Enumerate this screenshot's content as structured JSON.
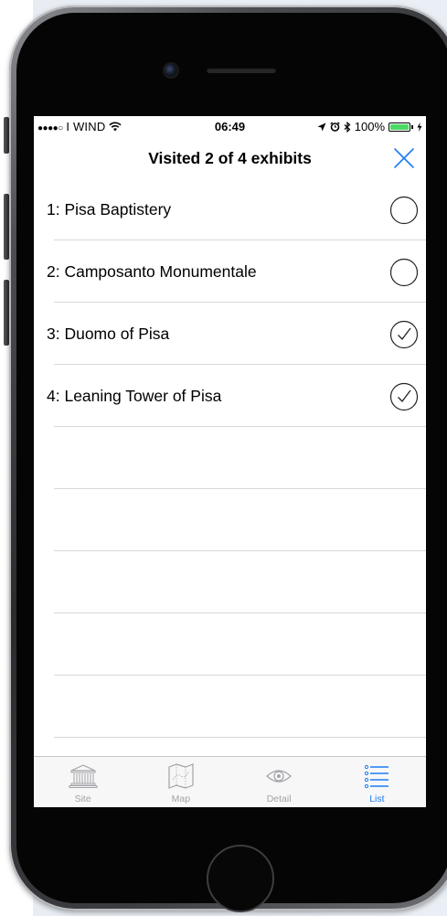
{
  "status_bar": {
    "signal_dots": "●●●●○",
    "carrier": "I WIND",
    "time": "06:49",
    "battery": "100%",
    "battery_level": 1.0
  },
  "nav": {
    "title": "Visited 2 of 4 exhibits",
    "close_icon": "close-icon"
  },
  "exhibits": [
    {
      "label": "1: Pisa Baptistery",
      "visited": false
    },
    {
      "label": "2: Camposanto Monumentale",
      "visited": false
    },
    {
      "label": "3: Duomo of Pisa",
      "visited": true
    },
    {
      "label": "4: Leaning Tower of Pisa",
      "visited": true
    }
  ],
  "tabs": [
    {
      "label": "Site",
      "icon": "museum-icon",
      "active": false
    },
    {
      "label": "Map",
      "icon": "map-icon",
      "active": false
    },
    {
      "label": "Detail",
      "icon": "eye-icon",
      "active": false
    },
    {
      "label": "List",
      "icon": "list-icon",
      "active": true
    }
  ],
  "colors": {
    "accent": "#1b7cf4",
    "inactive_tab": "#a3a3a8",
    "separator": "#d8d8dc",
    "battery": "#4cd964"
  }
}
